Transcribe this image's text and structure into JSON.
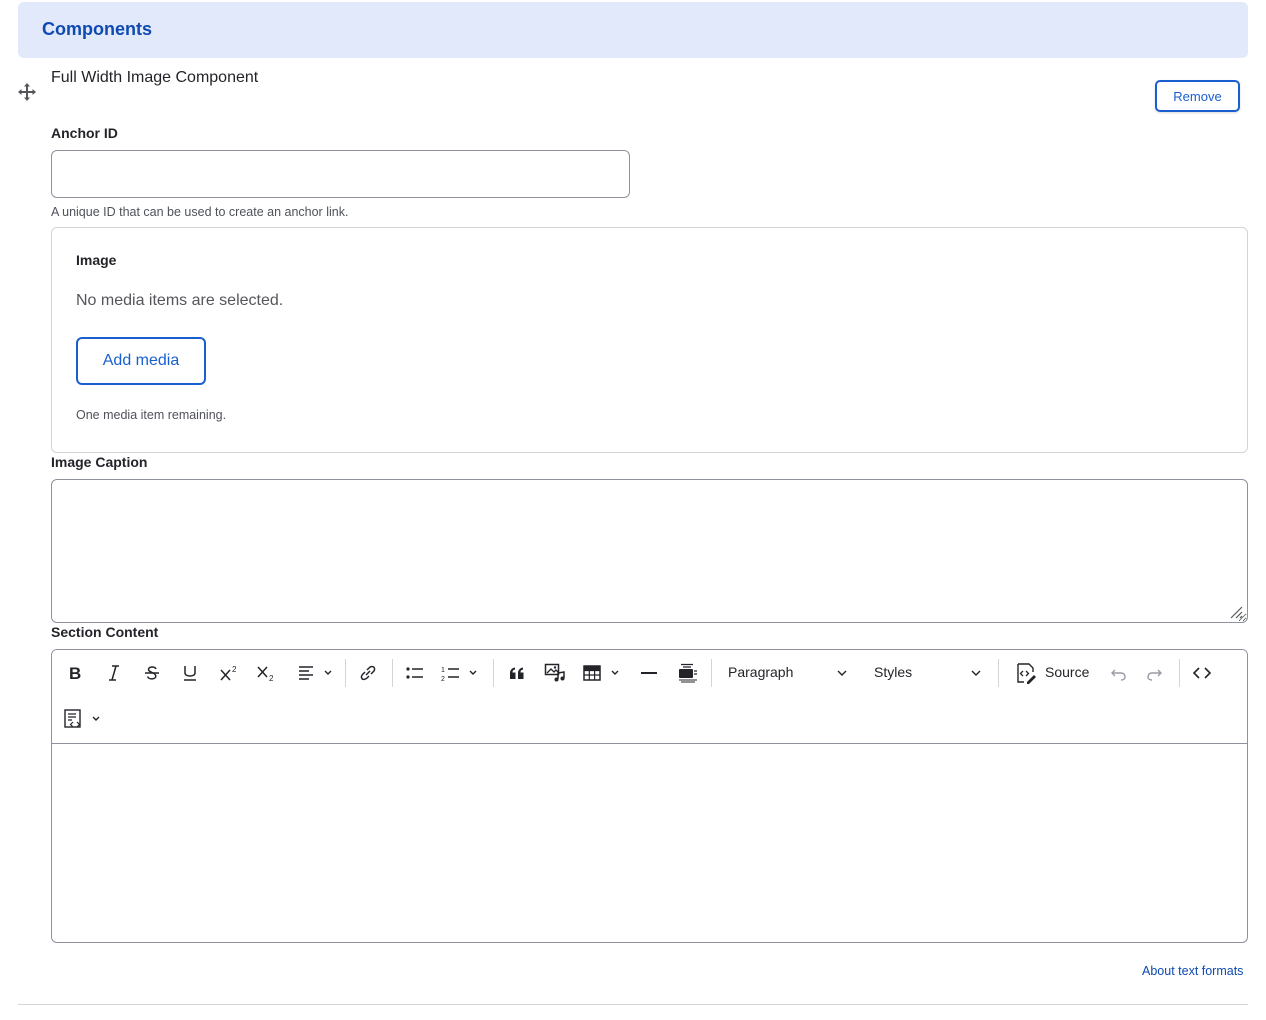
{
  "section": {
    "title": "Components"
  },
  "component": {
    "title": "Full Width Image Component",
    "remove_label": "Remove"
  },
  "anchor": {
    "label": "Anchor ID",
    "value": "",
    "help": "A unique ID that can be used to create an anchor link."
  },
  "image": {
    "label": "Image",
    "empty_text": "No media items are selected.",
    "add_label": "Add media",
    "remaining_text": "One media item remaining."
  },
  "caption": {
    "label": "Image Caption",
    "value": ""
  },
  "content": {
    "label": "Section Content",
    "toolbar": {
      "buttons": [
        "bold-icon",
        "italic-icon",
        "strikethrough-icon",
        "underline-icon",
        "superscript-icon",
        "subscript-icon",
        "align-icon",
        "link-icon",
        "bulleted-list-icon",
        "numbered-list-icon",
        "blockquote-icon",
        "media-icon",
        "table-icon",
        "horizontal-line-icon",
        "caption-icon",
        "undo-icon",
        "redo-icon",
        "code-icon",
        "code-block-icon"
      ],
      "heading_value": "Paragraph",
      "styles_value": "Styles",
      "source_label": "Source"
    },
    "about_formats": "About text formats"
  },
  "colors": {
    "accent": "#1a5fd0",
    "header_bg": "#e1e9fb",
    "header_text": "#0f4ab0"
  }
}
